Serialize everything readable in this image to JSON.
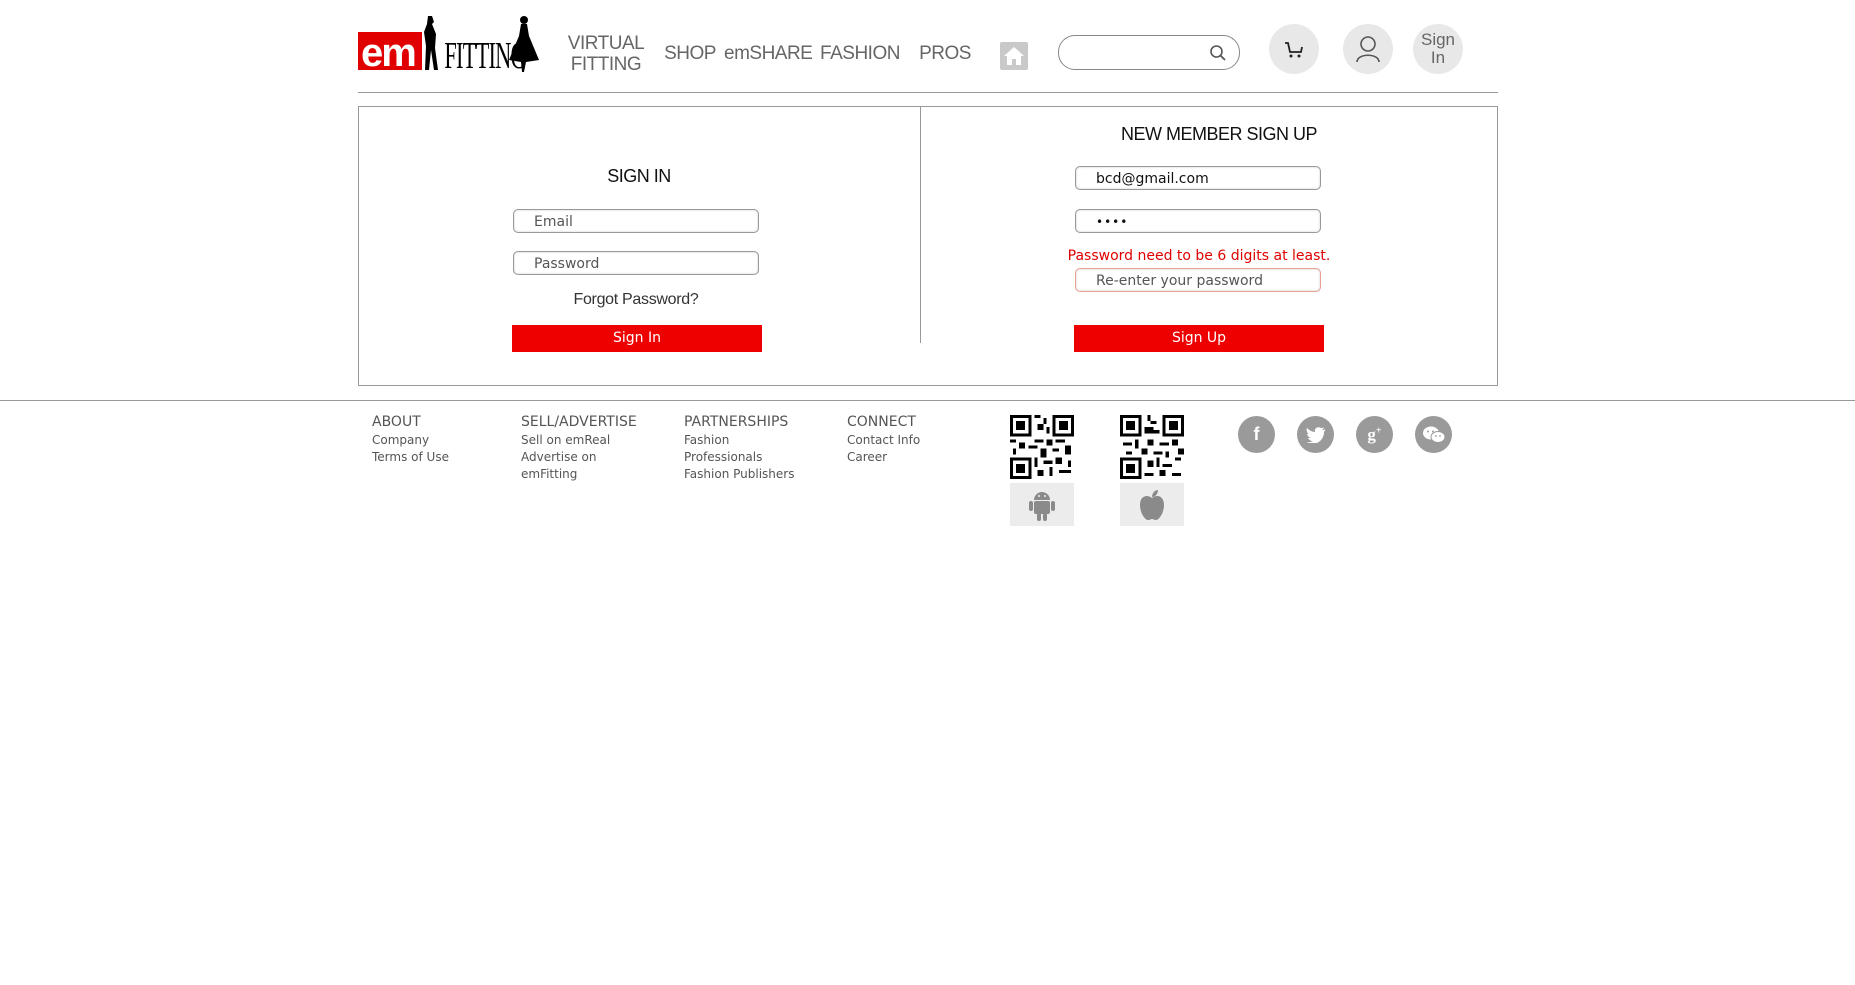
{
  "brand": {
    "logo_em": "em",
    "logo_fitting": "FITTING"
  },
  "nav": {
    "virtual_fitting_line1": "VIRTUAL",
    "virtual_fitting_line2": "FITTING",
    "shop": "SHOP",
    "emshare": "emSHARE",
    "fashion": "FASHION",
    "pros": "PROS"
  },
  "header": {
    "search_placeholder": "",
    "signin_line1": "Sign",
    "signin_line2": "In"
  },
  "signin": {
    "title": "SIGN IN",
    "email_placeholder": "Email",
    "password_placeholder": "Password",
    "forgot": "Forgot Password?",
    "button": "Sign In"
  },
  "signup": {
    "title": "NEW MEMBER SIGN UP",
    "email_value": "bcd@gmail.com",
    "password_value": "••••",
    "error": "Password need to be 6 digits at least.",
    "reenter_placeholder": "Re-enter your password",
    "button": "Sign Up"
  },
  "footer": {
    "about": {
      "title": "ABOUT",
      "links": [
        "Company",
        "Terms of Use"
      ]
    },
    "sell": {
      "title": "SELL/ADVERTISE",
      "links": [
        "Sell on emReal",
        "Advertise on",
        "emFitting"
      ]
    },
    "partnerships": {
      "title": "PARTNERSHIPS",
      "links": [
        "Fashion",
        "Professionals",
        "Fashion Publishers"
      ]
    },
    "connect": {
      "title": "CONNECT",
      "links": [
        "Contact Info",
        "Career"
      ]
    }
  },
  "colors": {
    "accent": "#ee0000",
    "error": "#e00000",
    "icon_grey": "#9a9a9a"
  },
  "icons": [
    "home-icon",
    "search-icon",
    "cart-icon",
    "user-icon",
    "facebook-icon",
    "twitter-icon",
    "google-plus-icon",
    "wechat-icon",
    "android-icon",
    "apple-icon",
    "qr-code-icon"
  ]
}
